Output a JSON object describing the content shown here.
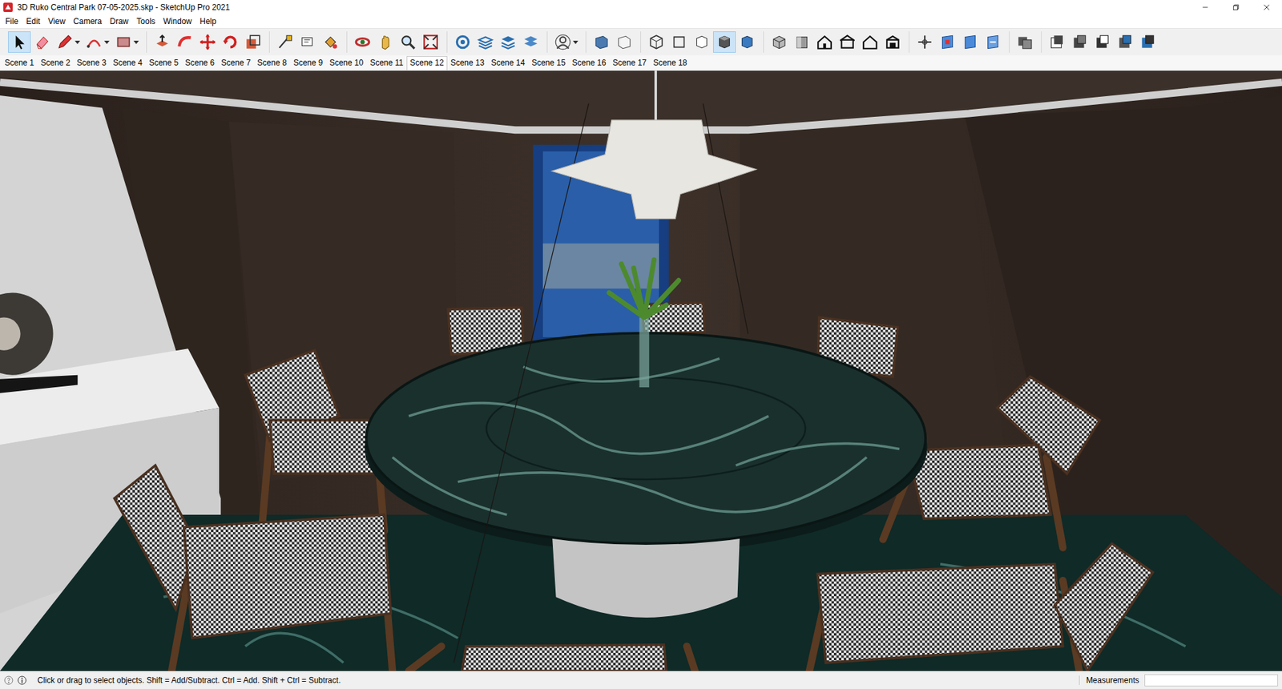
{
  "window": {
    "title": "3D Ruko Central Park 07-05-2025.skp - SketchUp Pro 2021"
  },
  "menu": [
    "File",
    "Edit",
    "View",
    "Camera",
    "Draw",
    "Tools",
    "Window",
    "Help"
  ],
  "toolbar": [
    {
      "tools": [
        {
          "selected": true,
          "dropdown": false
        },
        {
          "selected": false,
          "dropdown": false
        },
        {
          "selected": false,
          "dropdown": true
        },
        {
          "selected": false,
          "dropdown": true
        },
        {
          "selected": false,
          "dropdown": true
        }
      ]
    },
    {
      "tools": [
        {
          "selected": false,
          "dropdown": false
        },
        {
          "selected": false,
          "dropdown": false
        },
        {
          "selected": false,
          "dropdown": false
        },
        {
          "selected": false,
          "dropdown": false
        },
        {
          "selected": false,
          "dropdown": false
        }
      ]
    },
    {
      "tools": [
        {
          "selected": false,
          "dropdown": false
        },
        {
          "selected": false,
          "dropdown": false
        },
        {
          "selected": false,
          "dropdown": false
        }
      ]
    },
    {
      "tools": [
        {
          "selected": false,
          "dropdown": false
        },
        {
          "selected": false,
          "dropdown": false
        },
        {
          "selected": false,
          "dropdown": false
        },
        {
          "selected": false,
          "dropdown": false
        }
      ]
    },
    {
      "tools": [
        {
          "selected": false,
          "dropdown": false
        },
        {
          "selected": false,
          "dropdown": false
        },
        {
          "selected": false,
          "dropdown": false
        },
        {
          "selected": false,
          "dropdown": false
        }
      ]
    },
    {
      "tools": [
        {
          "selected": false,
          "dropdown": true
        }
      ]
    },
    {
      "tools": [
        {
          "selected": false,
          "dropdown": false
        },
        {
          "selected": false,
          "dropdown": false
        }
      ]
    },
    {
      "tools": [
        {
          "selected": false,
          "dropdown": false
        },
        {
          "selected": false,
          "dropdown": false
        },
        {
          "selected": false,
          "dropdown": false
        },
        {
          "selected": true,
          "dropdown": false
        },
        {
          "selected": false,
          "dropdown": false
        }
      ]
    },
    {
      "tools": [
        {
          "selected": false,
          "dropdown": false
        },
        {
          "selected": false,
          "dropdown": false
        },
        {
          "selected": false,
          "dropdown": false
        },
        {
          "selected": false,
          "dropdown": false
        },
        {
          "selected": false,
          "dropdown": false
        },
        {
          "selected": false,
          "dropdown": false
        }
      ]
    },
    {
      "tools": [
        {
          "selected": false,
          "dropdown": false
        },
        {
          "selected": false,
          "dropdown": false
        },
        {
          "selected": false,
          "dropdown": false
        },
        {
          "selected": false,
          "dropdown": false
        }
      ]
    },
    {
      "tools": [
        {
          "selected": false,
          "dropdown": false
        }
      ]
    },
    {
      "tools": [
        {
          "selected": false,
          "dropdown": false
        },
        {
          "selected": false,
          "dropdown": false
        },
        {
          "selected": false,
          "dropdown": false
        },
        {
          "selected": false,
          "dropdown": false
        },
        {
          "selected": false,
          "dropdown": false
        }
      ]
    }
  ],
  "scenes": [
    {
      "label": "Scene 1",
      "selected": false
    },
    {
      "label": "Scene 2",
      "selected": false
    },
    {
      "label": "Scene 3",
      "selected": false
    },
    {
      "label": "Scene 4",
      "selected": false
    },
    {
      "label": "Scene 5",
      "selected": false
    },
    {
      "label": "Scene 6",
      "selected": false
    },
    {
      "label": "Scene 7",
      "selected": false
    },
    {
      "label": "Scene 8",
      "selected": false
    },
    {
      "label": "Scene 9",
      "selected": false
    },
    {
      "label": "Scene 10",
      "selected": false
    },
    {
      "label": "Scene 11",
      "selected": false
    },
    {
      "label": "Scene 12",
      "selected": true
    },
    {
      "label": "Scene 13",
      "selected": false
    },
    {
      "label": "Scene 14",
      "selected": false
    },
    {
      "label": "Scene 15",
      "selected": false
    },
    {
      "label": "Scene 16",
      "selected": false
    },
    {
      "label": "Scene 17",
      "selected": false
    },
    {
      "label": "Scene 18",
      "selected": false
    }
  ],
  "status_bar": {
    "message": "Click or drag to select objects. Shift = Add/Subtract. Ctrl = Add. Shift + Ctrl = Subtract.",
    "measurements_label": "Measurements"
  }
}
